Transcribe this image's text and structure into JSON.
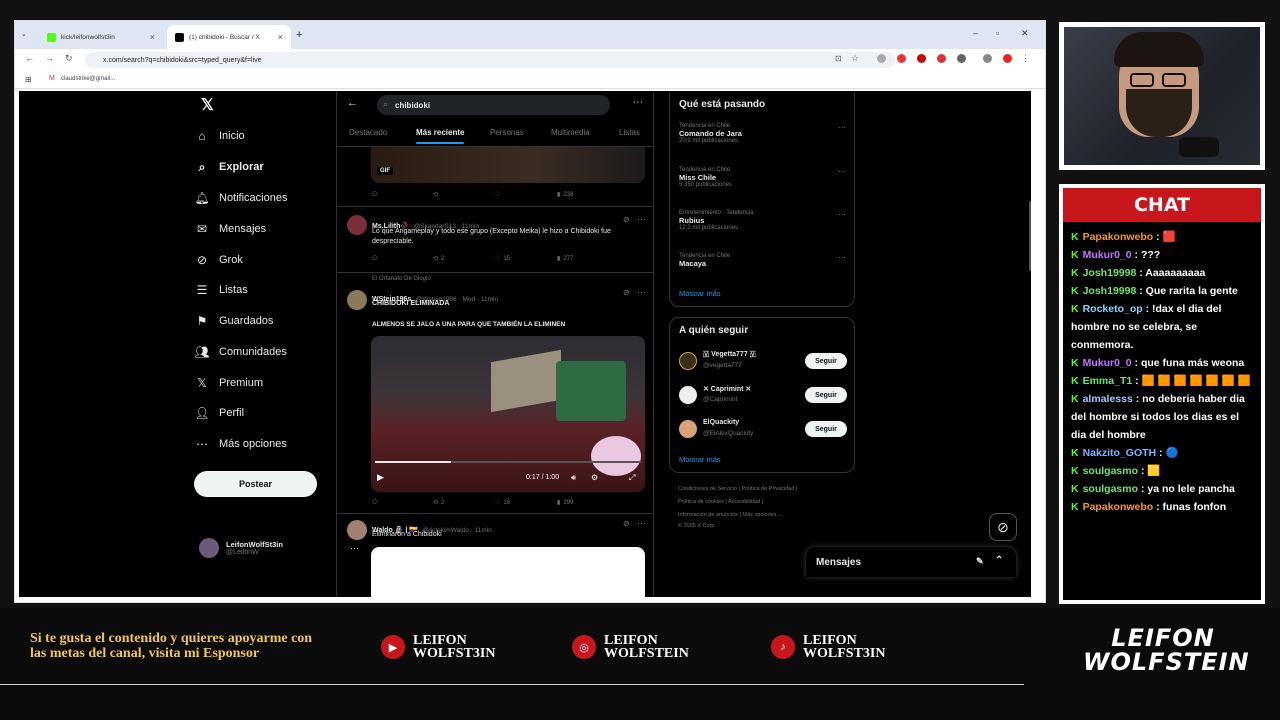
{
  "browser": {
    "tabs": [
      {
        "label": "kick/leifonwolfst3in"
      },
      {
        "label": "(1) chibidoki - Buscar / X"
      }
    ],
    "url": "x.com/search?q=chibidoki&src=typed_query&f=live",
    "bookmark": "claudstrike@gmail..."
  },
  "x_nav": {
    "items": [
      {
        "label": "Inicio",
        "icon": "home-icon"
      },
      {
        "label": "Explorar",
        "icon": "search-icon"
      },
      {
        "label": "Notificaciones",
        "icon": "bell-icon"
      },
      {
        "label": "Mensajes",
        "icon": "mail-icon"
      },
      {
        "label": "Grok",
        "icon": "grok-icon"
      },
      {
        "label": "Listas",
        "icon": "list-icon"
      },
      {
        "label": "Guardados",
        "icon": "bookmark-icon"
      },
      {
        "label": "Comunidades",
        "icon": "people-icon"
      },
      {
        "label": "Premium",
        "icon": "x-logo-icon"
      },
      {
        "label": "Perfil",
        "icon": "person-icon"
      },
      {
        "label": "Más opciones",
        "icon": "more-icon"
      }
    ],
    "post_label": "Postear",
    "profile_name": "LeifonWolfSt3in",
    "profile_handle": "@LeifonW"
  },
  "search": {
    "query": "chibidoki",
    "tabs": [
      "Destacado",
      "Más reciente",
      "Personas",
      "Multimedia",
      "Listas"
    ]
  },
  "tweets": [
    {
      "name": "Ms.Lilith🥀",
      "handle": "@SkandarS13 · 11min",
      "text": "Lo que Arigameplay y todo ese grupo (Excepto Meika) le hizo a Chibidoki fue despreciable.",
      "actions": [
        "",
        "2",
        "15",
        "277"
      ]
    },
    {
      "context": "El Orfanato De Glogio",
      "name": "WStein196s",
      "handle": "@Wstein1906 · Mod · 11min",
      "text1": "CHIBIDOKI ELIMINADA",
      "text2": "ALMENOS SE JALO A UNA PARA QUE TAMBIÉN LA ELIMINEN",
      "video_time": "0:17 / 1:00",
      "actions": [
        "",
        "2",
        "16",
        "299"
      ]
    },
    {
      "name": "Waldo 🗿 | 🇨🇴",
      "handle": "@ArlekimWaldo · 11min",
      "text": "Eliminaron a Chibidoki"
    }
  ],
  "first_actions": [
    "",
    "",
    "",
    "238"
  ],
  "gif_label": "GIF",
  "trends": {
    "title": "Qué está pasando",
    "items": [
      {
        "meta": "Tendencia en Chile",
        "name": "Comando de Jara",
        "count": "20,9 mil publicaciones"
      },
      {
        "meta": "Tendencia en Chile",
        "name": "Miss Chile",
        "count": "5.350 publicaciones"
      },
      {
        "meta": "Entretenimiento · Tendencia",
        "name": "Rubius",
        "count": "12,2 mil publicaciones"
      },
      {
        "meta": "Tendencia en Chile",
        "name": "Macaya",
        "count": ""
      }
    ],
    "more": "Mostrar más"
  },
  "follow": {
    "title": "A quién seguir",
    "items": [
      {
        "name": "🇻 Vegetta777 🇻",
        "handle": "@vegetta777",
        "btn": "Seguir"
      },
      {
        "name": "✕ Caprimint ✕",
        "handle": "@Caprimint",
        "btn": "Seguir"
      },
      {
        "name": "ElQuackity",
        "handle": "@ElAlexQuackity",
        "btn": "Seguir"
      }
    ],
    "more": "Mostrar más"
  },
  "footer": {
    "line1": "Condiciones de Servicio  |  Política de Privacidad  |",
    "line2": "Política de cookies  |  Accesibilidad  |",
    "line3": "Información de anuncios  |  Más opciones ...",
    "line4": "© 2025 X Corp."
  },
  "messages_label": "Mensajes",
  "chat": {
    "title": "CHAT",
    "messages": [
      {
        "user": "Papakonwebo",
        "color": "#f39c12",
        "text": ": 🟥"
      },
      {
        "user": "Mukur0_0",
        "color": "#c472ff",
        "text": ": ???"
      },
      {
        "user": "Josh19998",
        "color": "#6fe36f",
        "text": ": Aaaaaaaaaa"
      },
      {
        "user": "Josh19998",
        "color": "#6fe36f",
        "text": ": Que rarita la gente"
      },
      {
        "user": "Rocketo_op",
        "color": "#7fd7ff",
        "text": ": !dax el dia del hombre no se celebra, se conmemora."
      },
      {
        "user": "Mukur0_0",
        "color": "#c472ff",
        "text": ": que funa más weona"
      },
      {
        "user": "Emma_T1",
        "color": "#6fe36f",
        "text": ": 🟧 🟧 🟧 🟧 🟧 🟧 🟧"
      },
      {
        "user": "almalesss",
        "color": "#9fc8ff",
        "text": ": no deberia haber dia del hombre si todos los dias es el dia del hombre"
      },
      {
        "user": "Nakzito_GOTH",
        "color": "#7fb2ff",
        "text": ": 🔵"
      },
      {
        "user": "soulgasmo",
        "color": "#6fe36f",
        "text": ": 🟨"
      },
      {
        "user": "soulgasmo",
        "color": "#6fe36f",
        "text": ": ya no lele pancha"
      },
      {
        "user": "Papakonwebo",
        "color": "#f39c12",
        "text": ": funas fonfon"
      }
    ]
  },
  "banner": {
    "promo": "Si te gusta el contenido y quieres apoyarme con las metas del canal, visita mi Esponsor",
    "socials": [
      {
        "icon": "youtube-icon",
        "label": "LEIFON WOLFST3IN"
      },
      {
        "icon": "instagram-icon",
        "label": "LEIFON WOLFSTEIN"
      },
      {
        "icon": "tiktok-icon",
        "label": "LEIFON WOLFST3IN"
      }
    ],
    "logo1": "LEIFON",
    "logo2": "WOLFSTEIN"
  }
}
